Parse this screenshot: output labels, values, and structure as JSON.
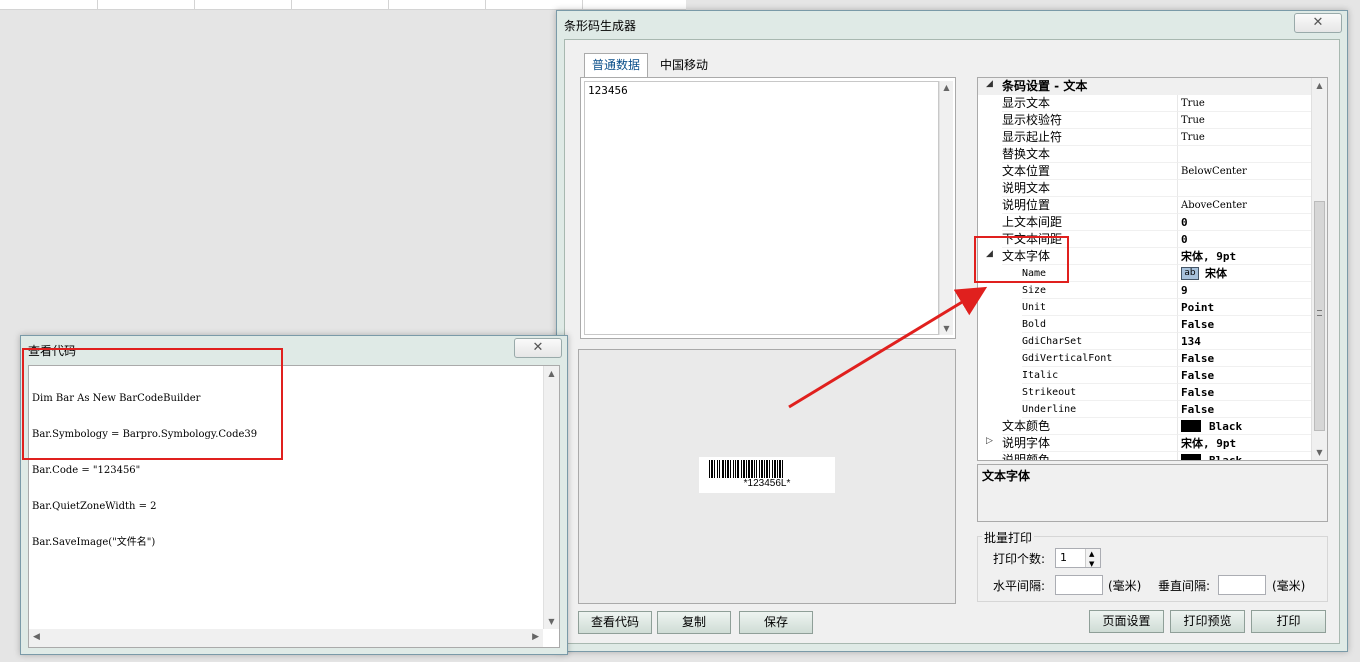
{
  "main_window": {
    "title": "条形码生成器",
    "close_glyph": "✕",
    "tabs": [
      {
        "label": "普通数据",
        "active": true
      },
      {
        "label": "中国移动",
        "active": false
      }
    ],
    "data_text": "123456",
    "barcode_text": "*123456L*",
    "buttons": {
      "view_code": "查看代码",
      "copy": "复制",
      "save": "保存",
      "page_setup": "页面设置",
      "print_preview": "打印预览",
      "print": "打印"
    },
    "property_grid": {
      "category": "条码设置 - 文本",
      "rows": [
        {
          "name": "显示文本",
          "value": "True"
        },
        {
          "name": "显示校验符",
          "value": "True"
        },
        {
          "name": "显示起止符",
          "value": "True"
        },
        {
          "name": "替换文本",
          "value": ""
        },
        {
          "name": "文本位置",
          "value": "BelowCenter"
        },
        {
          "name": "说明文本",
          "value": ""
        },
        {
          "name": "说明位置",
          "value": "AboveCenter"
        },
        {
          "name": "上文本间距",
          "value": "0"
        },
        {
          "name": "下文本间距",
          "value": "0"
        },
        {
          "name": "文本字体",
          "value": "宋体, 9pt"
        },
        {
          "name": "Name",
          "value": "宋体",
          "icon_text": "ab"
        },
        {
          "name": "Size",
          "value": "9"
        },
        {
          "name": "Unit",
          "value": "Point"
        },
        {
          "name": "Bold",
          "value": "False"
        },
        {
          "name": "GdiCharSet",
          "value": "134"
        },
        {
          "name": "GdiVerticalFont",
          "value": "False"
        },
        {
          "name": "Italic",
          "value": "False"
        },
        {
          "name": "Strikeout",
          "value": "False"
        },
        {
          "name": "Underline",
          "value": "False"
        },
        {
          "name": "文本颜色",
          "value": "Black"
        },
        {
          "name": "说明字体",
          "value": "宋体, 9pt"
        },
        {
          "name": "说明颜色",
          "value": "Black"
        }
      ]
    },
    "description_title": "文本字体",
    "batch_print": {
      "legend": "批量打印",
      "count_label": "打印个数:",
      "count_value": "1",
      "h_spacing_label": "水平间隔:",
      "h_unit": "(毫米)",
      "v_spacing_label": "垂直间隔:",
      "v_unit": "(毫米)"
    }
  },
  "code_window": {
    "title": "查看代码",
    "close_glyph": "✕",
    "code_lines": [
      "Dim Bar As New BarCodeBuilder",
      "Bar.Symbology = Barpro.Symbology.Code39",
      "Bar.Code = \"123456\"",
      "Bar.QuietZoneWidth = 2",
      "Bar.SaveImage(\"文件名\")"
    ]
  },
  "colors": {
    "annotation_red": "#e0201e",
    "window_border": "#7a9aa8",
    "active_tab_text": "#0a4f8a"
  }
}
